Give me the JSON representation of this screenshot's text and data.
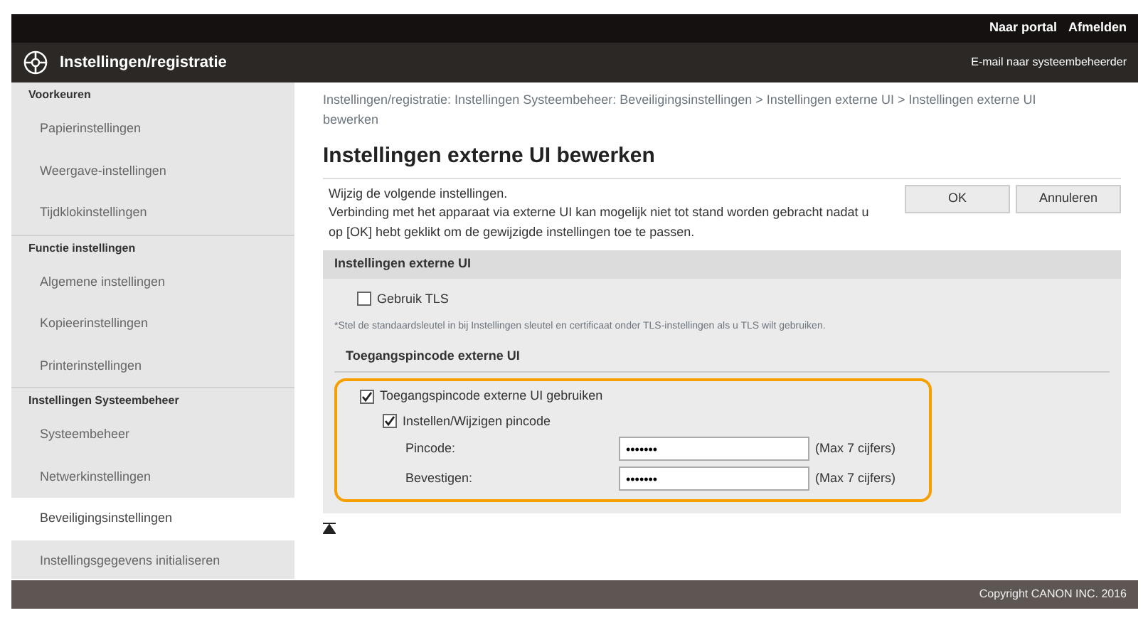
{
  "top_bar": {
    "links": [
      "Naar portal",
      "Afmelden"
    ]
  },
  "header": {
    "title": "Instellingen/registratie",
    "link": "E-mail naar systeembeheerder"
  },
  "sidebar": [
    {
      "heading": "Voorkeuren",
      "items": [
        {
          "label": "Papierinstellingen",
          "selected": false
        },
        {
          "label": "Weergave-instellingen",
          "selected": false
        },
        {
          "label": "Tijdklokinstellingen",
          "selected": false
        }
      ]
    },
    {
      "heading": "Functie instellingen",
      "items": [
        {
          "label": "Algemene instellingen",
          "selected": false
        },
        {
          "label": "Kopieerinstellingen",
          "selected": false
        },
        {
          "label": "Printerinstellingen",
          "selected": false
        }
      ]
    },
    {
      "heading": "Instellingen Systeembeheer",
      "items": [
        {
          "label": "Systeembeheer",
          "selected": false
        },
        {
          "label": "Netwerkinstellingen",
          "selected": false
        },
        {
          "label": "Beveiligingsinstellingen",
          "selected": true
        },
        {
          "label": "Instellingsgegevens initialiseren",
          "selected": false
        }
      ]
    }
  ],
  "breadcrumb": "Instellingen/registratie: Instellingen Systeembeheer: Beveiligingsinstellingen > Instellingen externe UI > Instellingen externe UI bewerken",
  "page_title": "Instellingen externe UI bewerken",
  "intro": [
    "Wijzig de volgende instellingen.",
    "Verbinding met het apparaat via externe UI kan mogelijk niet tot stand worden gebracht nadat u op [OK] hebt geklikt om de gewijzigde instellingen toe te passen."
  ],
  "buttons": [
    "OK",
    "Annuleren"
  ],
  "section": {
    "title": "Instellingen externe UI",
    "tls": {
      "label": "Gebruik TLS",
      "checked": false
    },
    "note": "*Stel de standaardsleutel in bij Instellingen sleutel en certificaat onder TLS-instellingen als u TLS wilt gebruiken.",
    "pin_title": "Toegangspincode externe UI",
    "pin_use": {
      "label": "Toegangspincode externe UI gebruiken",
      "checked": true
    },
    "pin_set": {
      "label": "Instellen/Wijzigen pincode",
      "checked": true
    },
    "fields": [
      {
        "label": "Pincode:",
        "value": "•••••••",
        "hint": "(Max 7 cijfers)"
      },
      {
        "label": "Bevestigen:",
        "value": "•••••••",
        "hint": "(Max 7 cijfers)"
      }
    ]
  },
  "footer": "Copyright CANON INC. 2016"
}
